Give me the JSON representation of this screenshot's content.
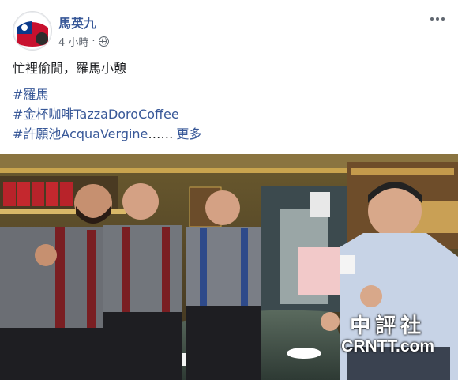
{
  "post": {
    "author": "馬英九",
    "timestamp": "4 小時",
    "separator": "·",
    "privacy_icon": "globe-icon",
    "menu_icon": "more-options-icon",
    "text_line": "忙裡偷閒，羅馬小憩",
    "hashtags": [
      "#羅馬",
      "#金杯咖啡TazzaDoroCoffee",
      "#許願池AcquaVergine"
    ],
    "ellipsis": "……",
    "see_more": "更多"
  },
  "photo": {
    "watermark_cn": "中評社",
    "watermark_en": "CRNTT.com"
  },
  "colors": {
    "link": "#385898",
    "meta": "#606770",
    "text": "#1c1e21"
  }
}
